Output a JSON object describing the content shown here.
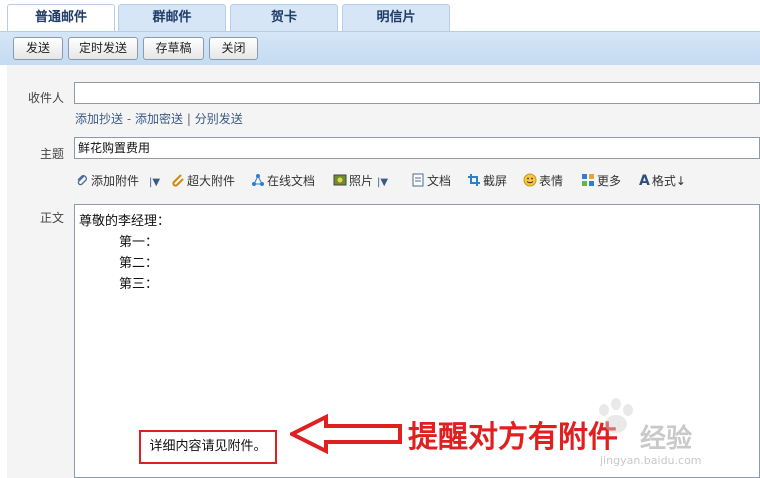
{
  "tabs": [
    {
      "label": "普通邮件",
      "active": true
    },
    {
      "label": "群邮件",
      "active": false
    },
    {
      "label": "贺卡",
      "active": false
    },
    {
      "label": "明信片",
      "active": false
    }
  ],
  "toolbar": {
    "send": "发送",
    "scheduled_send": "定时发送",
    "save_draft": "存草稿",
    "close": "关闭"
  },
  "form": {
    "recipient_label": "收件人",
    "recipient_value": "",
    "add_cc": "添加抄送",
    "dash": "-",
    "add_bcc": "添加密送",
    "pipe": "|",
    "separate_send": "分别发送",
    "subject_label": "主题",
    "subject_value": "鲜花购置费用",
    "body_label": "正文"
  },
  "attach_bar": {
    "add_attachment": "添加附件",
    "large_attachment": "超大附件",
    "online_doc": "在线文档",
    "photo": "照片",
    "document": "文档",
    "screenshot": "截屏",
    "emoji": "表情",
    "more": "更多",
    "format": "格式↓"
  },
  "body": {
    "greeting": "尊敬的李经理：",
    "line1": "第一：",
    "line2": "第二：",
    "line3": "第三：",
    "note": "详细内容请见附件。"
  },
  "annotation": {
    "text": "提醒对方有附件"
  },
  "watermark": {
    "text": "经验",
    "url": "jingyan.baidu.com"
  },
  "colors": {
    "tab_active_text": "#1f3b66",
    "toolbar_bg": "#c4dbf1",
    "annotation_red": "#e02020",
    "link_blue": "#3a5a88"
  }
}
